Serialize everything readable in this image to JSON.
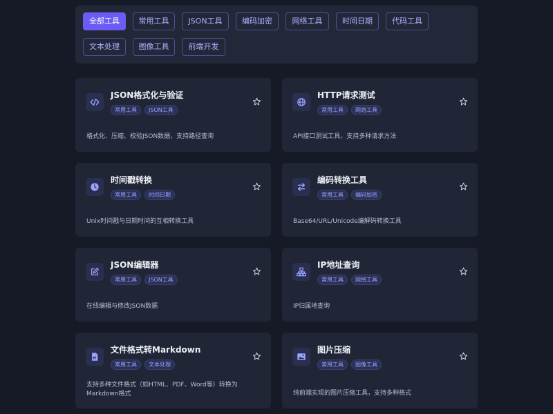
{
  "filters": [
    {
      "label": "全部工具",
      "active": true
    },
    {
      "label": "常用工具",
      "active": false
    },
    {
      "label": "JSON工具",
      "active": false
    },
    {
      "label": "编码加密",
      "active": false
    },
    {
      "label": "网络工具",
      "active": false
    },
    {
      "label": "时间日期",
      "active": false
    },
    {
      "label": "代码工具",
      "active": false
    },
    {
      "label": "文本处理",
      "active": false
    },
    {
      "label": "图像工具",
      "active": false
    },
    {
      "label": "前端开发",
      "active": false
    }
  ],
  "cards": [
    {
      "title": "JSON格式化与验证",
      "tags": [
        "常用工具",
        "JSON工具"
      ],
      "desc": "格式化、压缩、校验JSON数据，支持路径查询",
      "icon": "code-icon"
    },
    {
      "title": "HTTP请求测试",
      "tags": [
        "常用工具",
        "网络工具"
      ],
      "desc": "API接口测试工具，支持多种请求方法",
      "icon": "globe-icon"
    },
    {
      "title": "时间戳转换",
      "tags": [
        "常用工具",
        "时间日期"
      ],
      "desc": "Unix时间戳与日期时间的互相转换工具",
      "icon": "clock-icon"
    },
    {
      "title": "编码转换工具",
      "tags": [
        "常用工具",
        "编码加密"
      ],
      "desc": "Base64/URL/Unicode编解码转换工具",
      "icon": "swap-icon"
    },
    {
      "title": "JSON编辑器",
      "tags": [
        "常用工具",
        "JSON工具"
      ],
      "desc": "在线编辑与修改JSON数据",
      "icon": "edit-icon"
    },
    {
      "title": "IP地址查询",
      "tags": [
        "常用工具",
        "网络工具"
      ],
      "desc": "IP归属地查询",
      "icon": "network-icon"
    },
    {
      "title": "文件格式转Markdown",
      "tags": [
        "常用工具",
        "文本处理"
      ],
      "desc": "支持多种文件格式（如HTML、PDF、Word等）转换为Markdown格式",
      "icon": "file-icon"
    },
    {
      "title": "图片压缩",
      "tags": [
        "常用工具",
        "图像工具"
      ],
      "desc": "纯前端实现的图片压缩工具，支持多种格式",
      "icon": "image-icon"
    }
  ],
  "colors": {
    "accent": "#6a5cf5",
    "icon": "#9aa3ff"
  }
}
